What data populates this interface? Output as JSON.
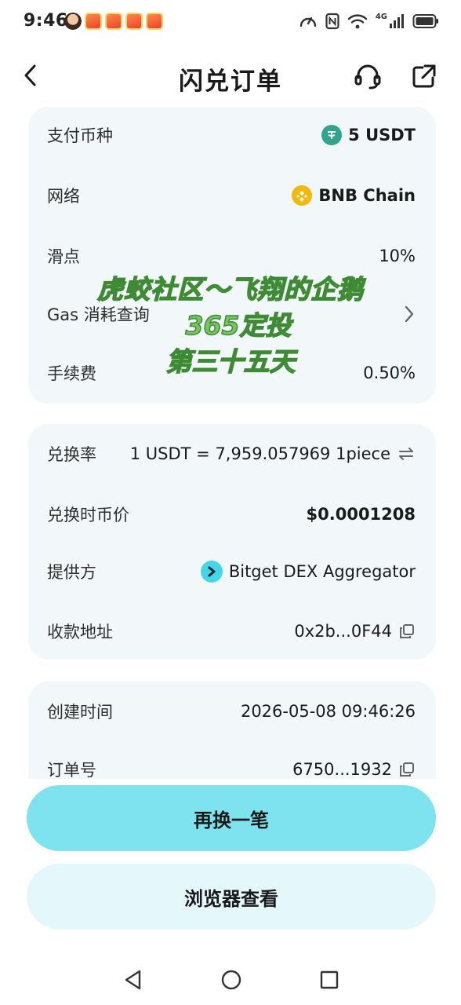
{
  "status_bar": {
    "time": "9:46",
    "network": "4G"
  },
  "header": {
    "title": "闪兑订单"
  },
  "summary": {
    "pay_currency_label": "支付币种",
    "pay_currency_value": "5 USDT",
    "network_label": "网络",
    "network_value": "BNB Chain",
    "slippage_label": "滑点",
    "slippage_value": "10%",
    "gas_label": "Gas 消耗查询",
    "fee_label": "手续费",
    "fee_value": "0.50%"
  },
  "watermark": {
    "line1": "虎蛟社区～飞翔的企鹅",
    "line2": "365定投",
    "line3": "第三十五天"
  },
  "details": {
    "rate_label": "兑换率",
    "rate_value": "1 USDT = 7,959.057969 1piece",
    "price_label": "兑换时币价",
    "price_value": "$0.0001208",
    "provider_label": "提供方",
    "provider_value": "Bitget DEX Aggregator",
    "address_label": "收款地址",
    "address_value": "0x2b...0F44"
  },
  "order": {
    "created_label": "创建时间",
    "created_value": "2026-05-08 09:46:26",
    "order_no_label": "订单号",
    "order_no_value": "6750...1932"
  },
  "actions": {
    "swap_again": "再换一笔",
    "view_in_browser": "浏览器查看"
  },
  "colors": {
    "primary_button": "#7ee3ef",
    "secondary_button": "#e4f8fb",
    "card_bg": "#f2f7f9",
    "watermark": "#79c462"
  }
}
